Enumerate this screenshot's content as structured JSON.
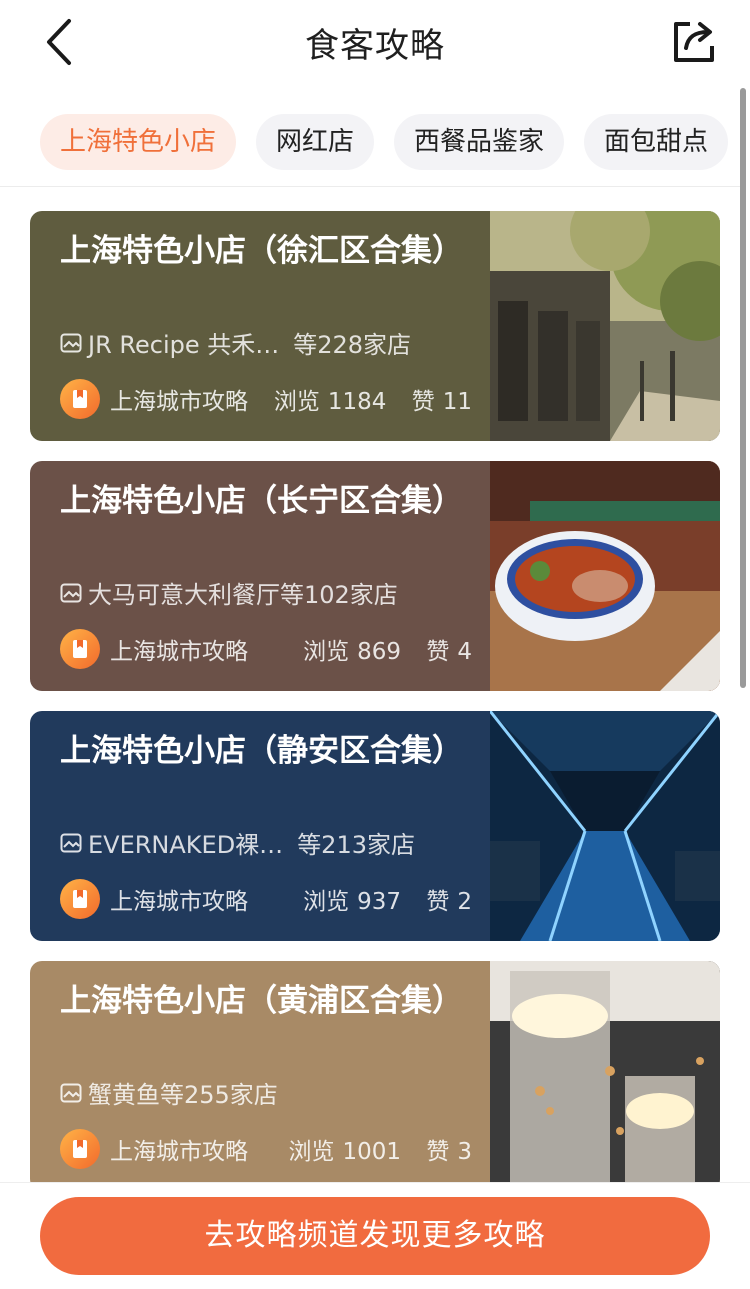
{
  "header": {
    "title": "食客攻略"
  },
  "tabs": [
    {
      "label": "上海特色小店",
      "active": true
    },
    {
      "label": "网红店",
      "active": false
    },
    {
      "label": "西餐品鉴家",
      "active": false
    },
    {
      "label": "面包甜点",
      "active": false
    }
  ],
  "cards": [
    {
      "title": "上海特色小店（徐汇区合集）",
      "subtitle_name": "JR Recipe 共禾…",
      "subtitle_count": "等228家店",
      "author": "上海城市攻略",
      "views_label": "浏览",
      "views": "1184",
      "likes_label": "赞",
      "likes": "11",
      "bg_color": "#5f5c3f"
    },
    {
      "title": "上海特色小店（长宁区合集）",
      "subtitle_name": "大马可意大利餐厅",
      "subtitle_count": "等102家店",
      "author": "上海城市攻略",
      "views_label": "浏览",
      "views": "869",
      "likes_label": "赞",
      "likes": "4",
      "bg_color": "#6b5148"
    },
    {
      "title": "上海特色小店（静安区合集）",
      "subtitle_name": "EVERNAKED裸…",
      "subtitle_count": "等213家店",
      "author": "上海城市攻略",
      "views_label": "浏览",
      "views": "937",
      "likes_label": "赞",
      "likes": "2",
      "bg_color": "#213a5c"
    },
    {
      "title": "上海特色小店（黄浦区合集）",
      "subtitle_name": "蟹黄鱼",
      "subtitle_count": "等255家店",
      "author": "上海城市攻略",
      "views_label": "浏览",
      "views": "1001",
      "likes_label": "赞",
      "likes": "3",
      "bg_color": "#a88a66"
    }
  ],
  "cta": {
    "label": "去攻略频道发现更多攻略"
  },
  "colors": {
    "accent": "#f16b3f",
    "tab_active_bg": "#fdece6",
    "tab_bg": "#f3f3f6"
  }
}
